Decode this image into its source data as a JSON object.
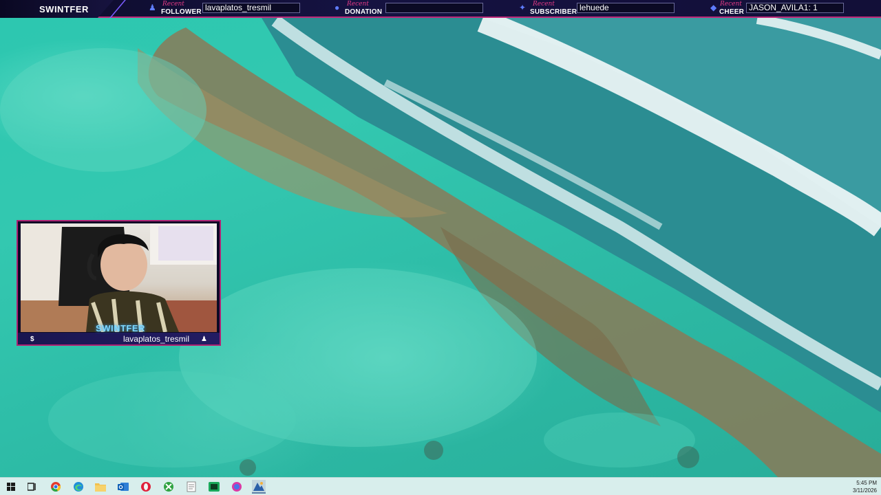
{
  "stream_overlay": {
    "brand": "SWINTFER",
    "segments": [
      {
        "tag": "Recent",
        "label": "FOLLOWER",
        "value": "lavaplatos_tresmil"
      },
      {
        "tag": "Recent",
        "label": "DONATION",
        "value": ""
      },
      {
        "tag": "Recent",
        "label": "SUBSCRIBER",
        "value": "lehuede"
      },
      {
        "tag": "Recent",
        "label": "CHEER",
        "value": "JASON_AVILA1: 1"
      }
    ],
    "webcam": {
      "name": "SWINTFER",
      "username": "lavaplatos_tresmil"
    }
  },
  "taskbar": {
    "items": [
      "windows-start",
      "task-view",
      "chrome",
      "edge",
      "file-explorer",
      "outlook-mail",
      "opera",
      "xbox",
      "file",
      "terminal",
      "app-red",
      "app-active"
    ],
    "clock": {
      "time": "5:45 PM",
      "date": "3/11/2026"
    }
  },
  "colors": {
    "accent": "#c0287a",
    "bar": "#151241",
    "cam_text": "#7ed8ff"
  }
}
